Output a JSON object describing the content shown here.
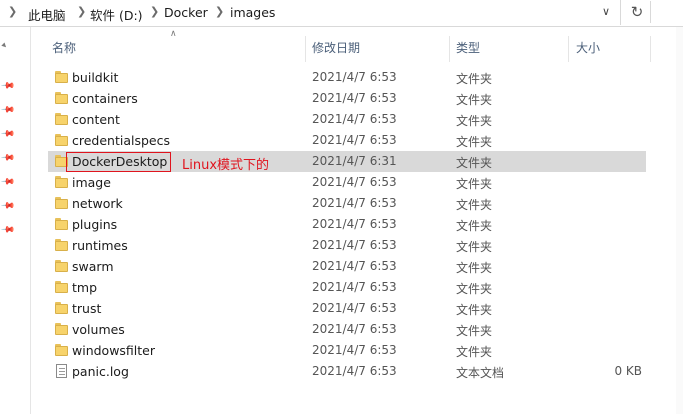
{
  "address": {
    "crumbs": [
      "此电脑",
      "软件 (D:)",
      "Docker",
      "images"
    ],
    "dropdown_icon": "chevron-down-icon",
    "refresh_icon": "refresh-icon"
  },
  "columns": {
    "name": "名称",
    "date": "修改日期",
    "type": "类型",
    "size": "大小"
  },
  "files": [
    {
      "name": "buildkit",
      "date": "2021/4/7 6:53",
      "type": "文件夹",
      "size": "",
      "kind": "folder"
    },
    {
      "name": "containers",
      "date": "2021/4/7 6:53",
      "type": "文件夹",
      "size": "",
      "kind": "folder"
    },
    {
      "name": "content",
      "date": "2021/4/7 6:53",
      "type": "文件夹",
      "size": "",
      "kind": "folder"
    },
    {
      "name": "credentialspecs",
      "date": "2021/4/7 6:53",
      "type": "文件夹",
      "size": "",
      "kind": "folder"
    },
    {
      "name": "DockerDesktop",
      "date": "2021/4/7 6:31",
      "type": "文件夹",
      "size": "",
      "kind": "folder",
      "selected": true
    },
    {
      "name": "image",
      "date": "2021/4/7 6:53",
      "type": "文件夹",
      "size": "",
      "kind": "folder"
    },
    {
      "name": "network",
      "date": "2021/4/7 6:53",
      "type": "文件夹",
      "size": "",
      "kind": "folder"
    },
    {
      "name": "plugins",
      "date": "2021/4/7 6:53",
      "type": "文件夹",
      "size": "",
      "kind": "folder"
    },
    {
      "name": "runtimes",
      "date": "2021/4/7 6:53",
      "type": "文件夹",
      "size": "",
      "kind": "folder"
    },
    {
      "name": "swarm",
      "date": "2021/4/7 6:53",
      "type": "文件夹",
      "size": "",
      "kind": "folder"
    },
    {
      "name": "tmp",
      "date": "2021/4/7 6:53",
      "type": "文件夹",
      "size": "",
      "kind": "folder"
    },
    {
      "name": "trust",
      "date": "2021/4/7 6:53",
      "type": "文件夹",
      "size": "",
      "kind": "folder"
    },
    {
      "name": "volumes",
      "date": "2021/4/7 6:53",
      "type": "文件夹",
      "size": "",
      "kind": "folder"
    },
    {
      "name": "windowsfilter",
      "date": "2021/4/7 6:53",
      "type": "文件夹",
      "size": "",
      "kind": "folder"
    },
    {
      "name": "panic.log",
      "date": "2021/4/7 6:53",
      "type": "文本文档",
      "size": "0 KB",
      "kind": "file"
    }
  ],
  "annotation": {
    "text": "Linux模式下的",
    "color": "#e0141e"
  }
}
